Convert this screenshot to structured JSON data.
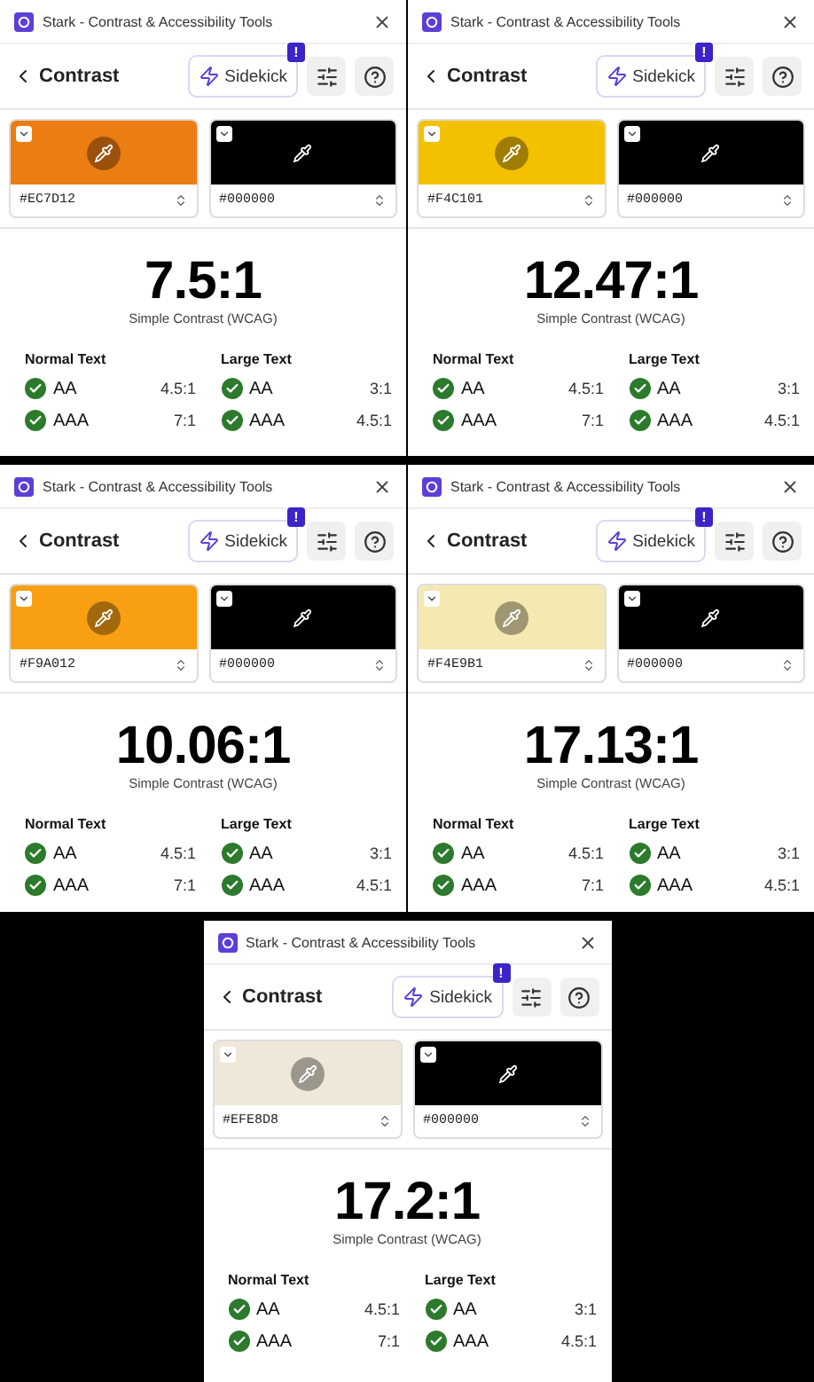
{
  "panels": [
    {
      "title": "Stark - Contrast & Accessibility Tools",
      "back": "Contrast",
      "sidekick": "Sidekick",
      "badge": "!",
      "swatches": [
        {
          "hex": "#EC7D12",
          "color": "#ec7d12"
        },
        {
          "hex": "#000000",
          "color": "#000000"
        }
      ],
      "ratio": "7.5:1",
      "method": "Simple Contrast (WCAG)",
      "groups": [
        {
          "heading": "Normal Text",
          "checks": [
            {
              "level": "AA",
              "pass": true,
              "threshold": "4.5:1"
            },
            {
              "level": "AAA",
              "pass": true,
              "threshold": "7:1"
            }
          ]
        },
        {
          "heading": "Large Text",
          "checks": [
            {
              "level": "AA",
              "pass": true,
              "threshold": "3:1"
            },
            {
              "level": "AAA",
              "pass": true,
              "threshold": "4.5:1"
            }
          ]
        }
      ]
    },
    {
      "title": "Stark - Contrast & Accessibility Tools",
      "back": "Contrast",
      "sidekick": "Sidekick",
      "badge": "!",
      "swatches": [
        {
          "hex": "#F4C101",
          "color": "#f4c101"
        },
        {
          "hex": "#000000",
          "color": "#000000"
        }
      ],
      "ratio": "12.47:1",
      "method": "Simple Contrast (WCAG)",
      "groups": [
        {
          "heading": "Normal Text",
          "checks": [
            {
              "level": "AA",
              "pass": true,
              "threshold": "4.5:1"
            },
            {
              "level": "AAA",
              "pass": true,
              "threshold": "7:1"
            }
          ]
        },
        {
          "heading": "Large Text",
          "checks": [
            {
              "level": "AA",
              "pass": true,
              "threshold": "3:1"
            },
            {
              "level": "AAA",
              "pass": true,
              "threshold": "4.5:1"
            }
          ]
        }
      ]
    },
    {
      "title": "Stark - Contrast & Accessibility Tools",
      "back": "Contrast",
      "sidekick": "Sidekick",
      "badge": "!",
      "swatches": [
        {
          "hex": "#F9A012",
          "color": "#f9a012"
        },
        {
          "hex": "#000000",
          "color": "#000000"
        }
      ],
      "ratio": "10.06:1",
      "method": "Simple Contrast (WCAG)",
      "groups": [
        {
          "heading": "Normal Text",
          "checks": [
            {
              "level": "AA",
              "pass": true,
              "threshold": "4.5:1"
            },
            {
              "level": "AAA",
              "pass": true,
              "threshold": "7:1"
            }
          ]
        },
        {
          "heading": "Large Text",
          "checks": [
            {
              "level": "AA",
              "pass": true,
              "threshold": "3:1"
            },
            {
              "level": "AAA",
              "pass": true,
              "threshold": "4.5:1"
            }
          ]
        }
      ]
    },
    {
      "title": "Stark - Contrast & Accessibility Tools",
      "back": "Contrast",
      "sidekick": "Sidekick",
      "badge": "!",
      "swatches": [
        {
          "hex": "#F4E9B1",
          "color": "#f4e9b1"
        },
        {
          "hex": "#000000",
          "color": "#000000"
        }
      ],
      "ratio": "17.13:1",
      "method": "Simple Contrast (WCAG)",
      "groups": [
        {
          "heading": "Normal Text",
          "checks": [
            {
              "level": "AA",
              "pass": true,
              "threshold": "4.5:1"
            },
            {
              "level": "AAA",
              "pass": true,
              "threshold": "7:1"
            }
          ]
        },
        {
          "heading": "Large Text",
          "checks": [
            {
              "level": "AA",
              "pass": true,
              "threshold": "3:1"
            },
            {
              "level": "AAA",
              "pass": true,
              "threshold": "4.5:1"
            }
          ]
        }
      ]
    },
    {
      "title": "Stark - Contrast & Accessibility Tools",
      "back": "Contrast",
      "sidekick": "Sidekick",
      "badge": "!",
      "swatches": [
        {
          "hex": "#EFE8D8",
          "color": "#efe8d8"
        },
        {
          "hex": "#000000",
          "color": "#000000"
        }
      ],
      "ratio": "17.2:1",
      "method": "Simple Contrast (WCAG)",
      "groups": [
        {
          "heading": "Normal Text",
          "checks": [
            {
              "level": "AA",
              "pass": true,
              "threshold": "4.5:1"
            },
            {
              "level": "AAA",
              "pass": true,
              "threshold": "7:1"
            }
          ]
        },
        {
          "heading": "Large Text",
          "checks": [
            {
              "level": "AA",
              "pass": true,
              "threshold": "3:1"
            },
            {
              "level": "AAA",
              "pass": true,
              "threshold": "4.5:1"
            }
          ]
        }
      ]
    }
  ]
}
